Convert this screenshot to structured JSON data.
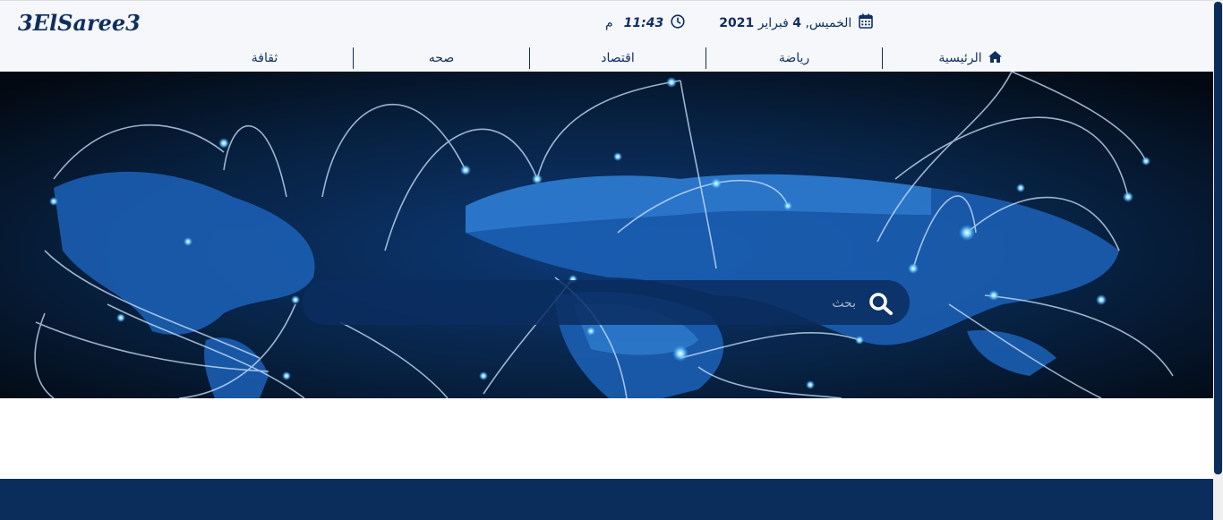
{
  "header": {
    "logo": "3ElSaree3",
    "time": "11:43",
    "ampm": "م",
    "date_day": "الخميس,",
    "date_num": "4",
    "date_month": "فبراير",
    "date_year": "2021",
    "clock_icon": "clock-icon",
    "calendar_icon": "calendar-icon"
  },
  "nav": {
    "items": [
      {
        "label": "الرئيسية",
        "icon": "home-icon"
      },
      {
        "label": "رياضة"
      },
      {
        "label": "اقتصاد"
      },
      {
        "label": "صحه"
      },
      {
        "label": "ثقافة"
      }
    ]
  },
  "search": {
    "placeholder": "بحث",
    "icon": "search-icon"
  },
  "colors": {
    "brand": "#0f2f5f",
    "footer": "#0b2d5c",
    "header_bg": "#f6f7fb"
  }
}
